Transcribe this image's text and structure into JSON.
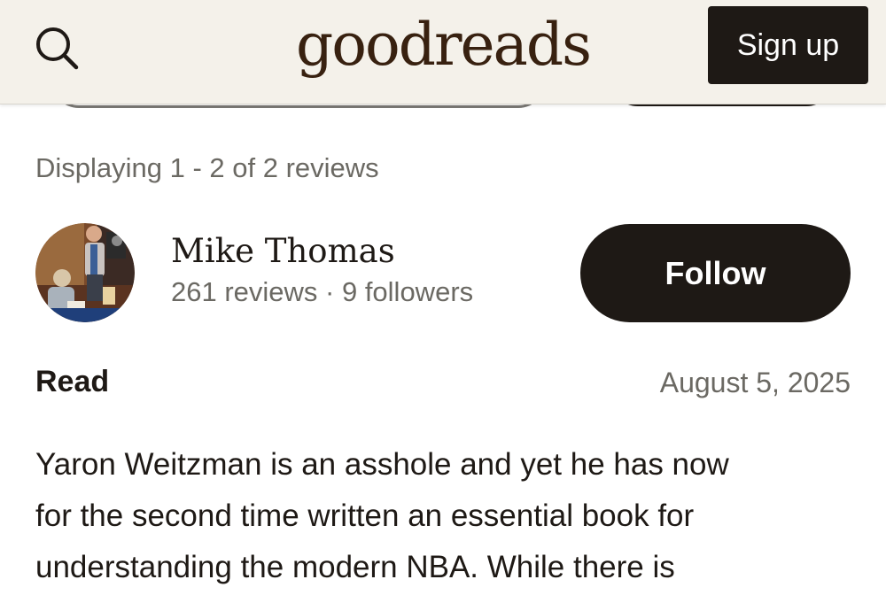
{
  "header": {
    "logo_text": "goodreads",
    "signup_label": "Sign up",
    "search_icon": "search-icon"
  },
  "reviews_summary": "Displaying 1 - 2 of 2 reviews",
  "review": {
    "reviewer": {
      "name": "Mike Thomas",
      "stats": "261 reviews · 9 followers",
      "follow_label": "Follow"
    },
    "shelf": "Read",
    "date": "August 5, 2025",
    "text_lines": [
      "Yaron Weitzman is an asshole and yet he has now",
      "for the second time written an essential book for",
      "understanding the modern NBA. While there is"
    ]
  },
  "colors": {
    "header_bg": "#f4f1ea",
    "logo": "#382110",
    "button_dark": "#1e1915",
    "muted_text": "#6b6963"
  }
}
